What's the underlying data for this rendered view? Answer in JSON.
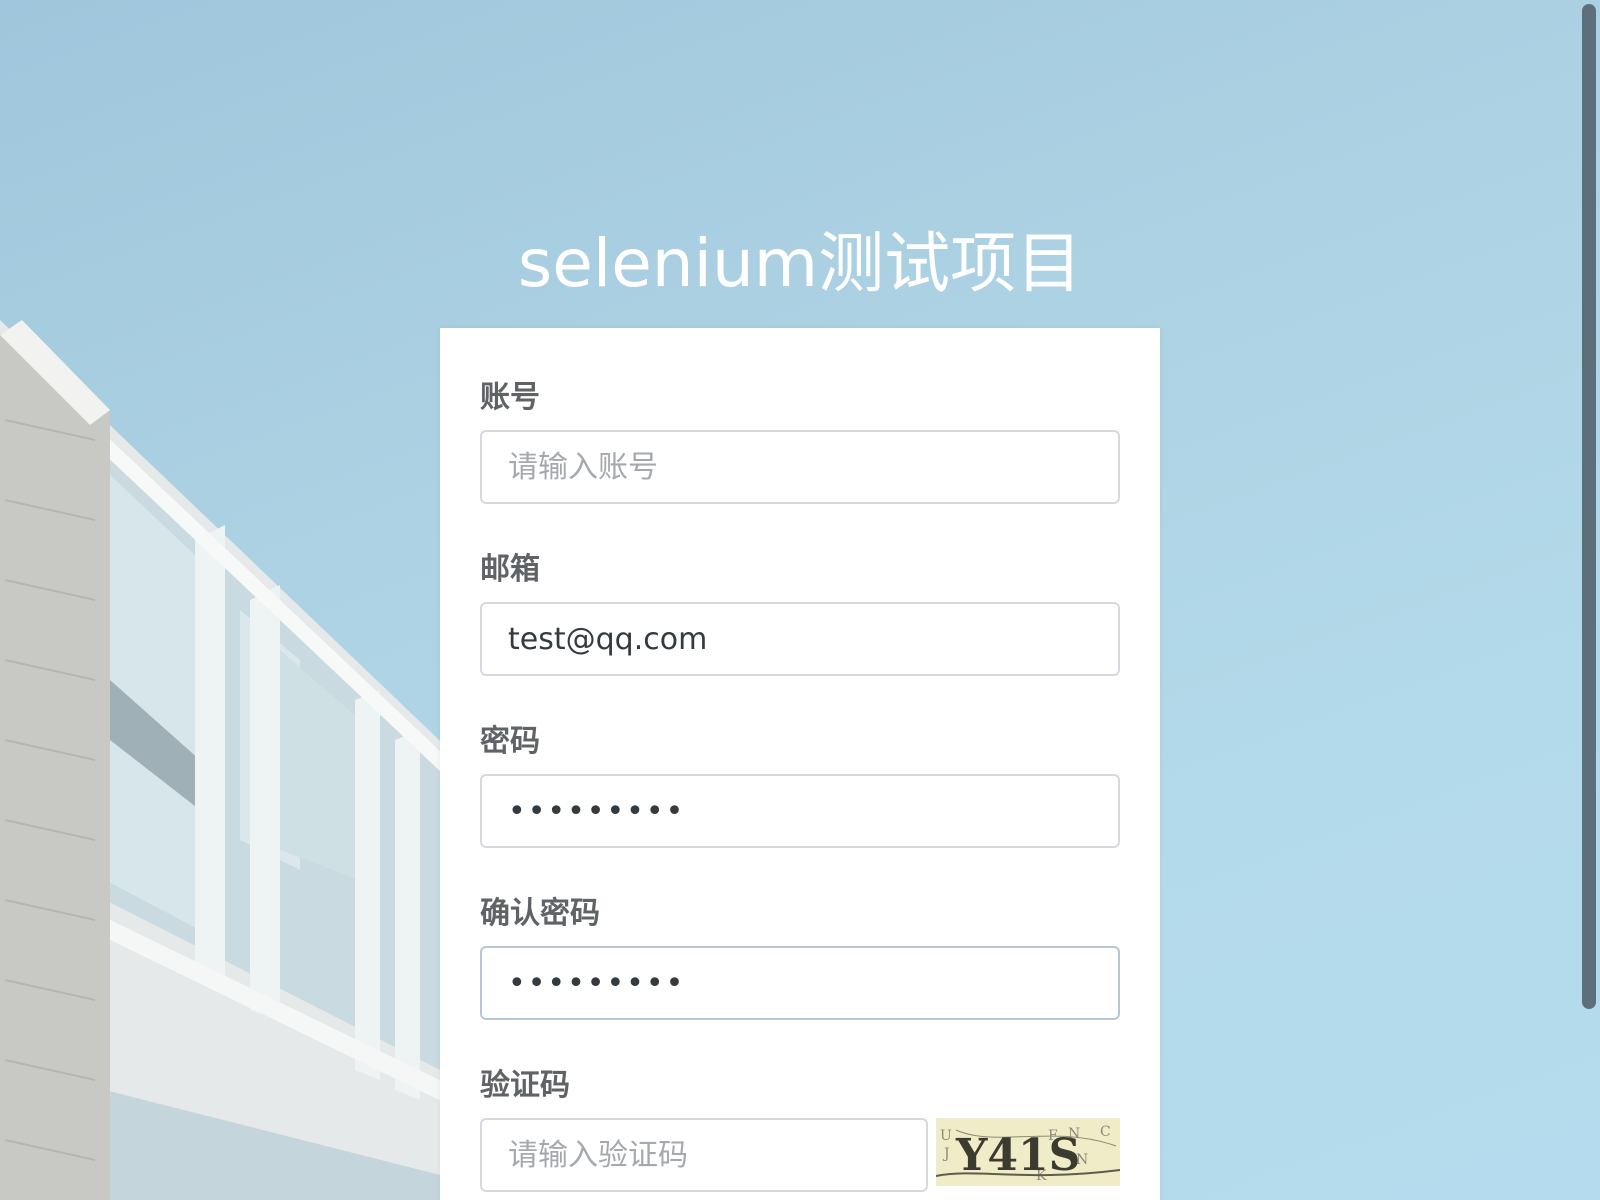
{
  "page": {
    "title": "selenium测试项目"
  },
  "form": {
    "account": {
      "label": "账号",
      "placeholder": "请输入账号",
      "value": ""
    },
    "email": {
      "label": "邮箱",
      "value": "test@qq.com"
    },
    "password": {
      "label": "密码",
      "value": "123456789"
    },
    "confirm_password": {
      "label": "确认密码",
      "value": "123456789"
    },
    "captcha": {
      "label": "验证码",
      "placeholder": "请输入验证码",
      "value": "",
      "image_text": "Y41S"
    }
  },
  "colors": {
    "background": "#acd1e3",
    "title": "#ffffff",
    "label": "#5f6368",
    "input_border": "#d5d9de",
    "scrollbar": "#5c6f7a"
  }
}
